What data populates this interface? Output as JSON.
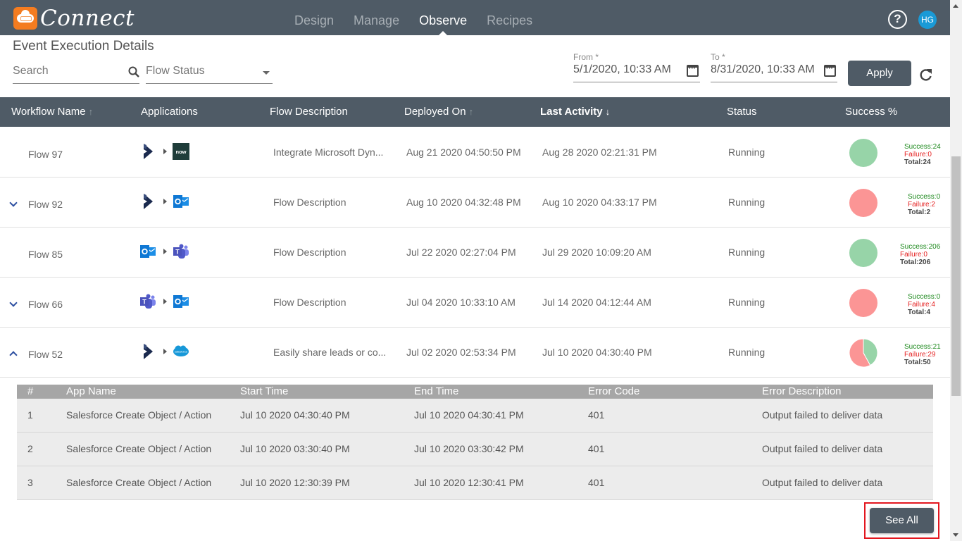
{
  "header": {
    "app_name": "Connect",
    "nav": [
      {
        "label": "Design",
        "active": false
      },
      {
        "label": "Manage",
        "active": false
      },
      {
        "label": "Observe",
        "active": true
      },
      {
        "label": "Recipes",
        "active": false
      }
    ],
    "help_icon": "question-circle-icon",
    "user_initials": "HG",
    "avatar_color": "#1a9ad6"
  },
  "page": {
    "title": "Event Execution Details"
  },
  "filters": {
    "search_placeholder": "Search",
    "flow_status_placeholder": "Flow Status",
    "from_label": "From *",
    "from_value": "5/1/2020, 10:33 AM",
    "to_label": "To *",
    "to_value": "8/31/2020, 10:33 AM",
    "apply_label": "Apply"
  },
  "table": {
    "columns": [
      {
        "label": "Workflow Name",
        "sort": "up",
        "active": false
      },
      {
        "label": "Applications",
        "sort": null,
        "active": false
      },
      {
        "label": "Flow Description",
        "sort": null,
        "active": false
      },
      {
        "label": "Deployed On",
        "sort": "up",
        "active": false
      },
      {
        "label": "Last Activity",
        "sort": "down",
        "active": true
      },
      {
        "label": "Status",
        "sort": null,
        "active": false
      },
      {
        "label": "Success %",
        "sort": null,
        "active": false
      }
    ],
    "rows": [
      {
        "name": "Flow 97",
        "expander": "none",
        "apps": [
          "dynamics",
          "servicenow"
        ],
        "description": "Integrate Microsoft Dyn...",
        "deployed_on": "Aug 21 2020 04:50:50 PM",
        "last_activity": "Aug 28 2020 02:21:31 PM",
        "status": "Running",
        "success": 24,
        "failure": 0,
        "total": 24,
        "success_label": "Success:24",
        "failure_label": "Failure:0",
        "total_label": "Total:24"
      },
      {
        "name": "Flow 92",
        "expander": "collapsed",
        "apps": [
          "dynamics",
          "outlook"
        ],
        "description": "Flow Description",
        "deployed_on": "Aug 10 2020 04:32:48 PM",
        "last_activity": "Aug 10 2020 04:33:17 PM",
        "status": "Running",
        "success": 0,
        "failure": 2,
        "total": 2,
        "success_label": "Success:0",
        "failure_label": "Failure:2",
        "total_label": "Total:2"
      },
      {
        "name": "Flow 85",
        "expander": "none",
        "apps": [
          "outlook",
          "teams"
        ],
        "description": "Flow Description",
        "deployed_on": "Jul 22 2020 02:27:04 PM",
        "last_activity": "Jul 29 2020 10:09:20 AM",
        "status": "Running",
        "success": 206,
        "failure": 0,
        "total": 206,
        "success_label": "Success:206",
        "failure_label": "Failure:0",
        "total_label": "Total:206"
      },
      {
        "name": "Flow 66",
        "expander": "collapsed",
        "apps": [
          "teams",
          "outlook"
        ],
        "description": "Flow Description",
        "deployed_on": "Jul 04 2020 10:33:10 AM",
        "last_activity": "Jul 14 2020 04:12:44 AM",
        "status": "Running",
        "success": 0,
        "failure": 4,
        "total": 4,
        "success_label": "Success:0",
        "failure_label": "Failure:4",
        "total_label": "Total:4"
      },
      {
        "name": "Flow 52",
        "expander": "expanded",
        "apps": [
          "dynamics",
          "salesforce"
        ],
        "description": "Easily share leads or co...",
        "deployed_on": "Jul 02 2020 02:53:34 PM",
        "last_activity": "Jul 10 2020 04:30:40 PM",
        "status": "Running",
        "success": 21,
        "failure": 29,
        "total": 50,
        "success_label": "Success:21",
        "failure_label": "Failure:29",
        "total_label": "Total:50"
      }
    ],
    "colors": {
      "success": "#97d4a8",
      "failure": "#fb9595"
    }
  },
  "details": {
    "columns": [
      "#",
      "App Name",
      "Start Time",
      "End Time",
      "Error Code",
      "Error Description"
    ],
    "rows": [
      {
        "num": "1",
        "app": "Salesforce Create Object / Action",
        "start": "Jul 10 2020 04:30:40 PM",
        "end": "Jul 10 2020 04:30:41 PM",
        "code": "401",
        "desc": "Output failed to deliver data"
      },
      {
        "num": "2",
        "app": "Salesforce Create Object / Action",
        "start": "Jul 10 2020 03:30:40 PM",
        "end": "Jul 10 2020 03:30:42 PM",
        "code": "401",
        "desc": "Output failed to deliver data"
      },
      {
        "num": "3",
        "app": "Salesforce Create Object / Action",
        "start": "Jul 10 2020 12:30:39 PM",
        "end": "Jul 10 2020 12:30:41 PM",
        "code": "401",
        "desc": "Output failed to deliver data"
      }
    ],
    "see_all_label": "See All"
  }
}
